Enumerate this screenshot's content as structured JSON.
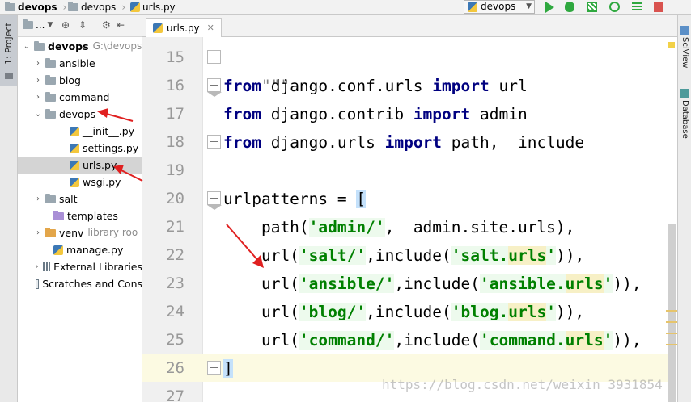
{
  "breadcrumb": [
    "devops",
    "devops",
    "urls.py"
  ],
  "run_config": "devops",
  "project_panel": {
    "title": "...",
    "root_name": "devops",
    "root_path": "G:\\devops",
    "items": [
      {
        "label": "ansible",
        "type": "folder",
        "expand": "closed"
      },
      {
        "label": "blog",
        "type": "folder",
        "expand": "closed"
      },
      {
        "label": "command",
        "type": "folder",
        "expand": "closed"
      },
      {
        "label": "devops",
        "type": "folder",
        "expand": "open"
      },
      {
        "label": "__init__.py",
        "type": "py"
      },
      {
        "label": "settings.py",
        "type": "py"
      },
      {
        "label": "urls.py",
        "type": "py"
      },
      {
        "label": "wsgi.py",
        "type": "py"
      },
      {
        "label": "salt",
        "type": "folder",
        "expand": "closed"
      },
      {
        "label": "templates",
        "type": "folder"
      },
      {
        "label": "venv",
        "type": "folder",
        "expand": "closed",
        "meta": "library roo"
      },
      {
        "label": "manage.py",
        "type": "py"
      },
      {
        "label": "External Libraries",
        "type": "lib"
      },
      {
        "label": "Scratches and Cons",
        "type": "scratch"
      }
    ]
  },
  "left_tool_tab": "1: Project",
  "right_tool_tabs": [
    "SciView",
    "Database"
  ],
  "editor_tab": "urls.py",
  "line_numbers": [
    "15",
    "16",
    "17",
    "18",
    "19",
    "20",
    "21",
    "22",
    "23",
    "24",
    "25",
    "26",
    "27"
  ],
  "code": {
    "l15": "\"\"\"",
    "kw_from": "from",
    "kw_import": "import",
    "l16_mod": " django.conf.urls ",
    "l16_name": " url",
    "l17_mod": " django.contrib ",
    "l17_name": " admin",
    "l18_mod": " django.urls ",
    "l18_name": " path,  include",
    "l20_var": "urlpatterns = ",
    "l20_bracket": "[",
    "l21_pre": "    path(",
    "l21_str": "'admin/'",
    "l21_post": ",  admin.site.urls),",
    "url_pre": "    url(",
    "include_pre": ",include(",
    "urls_word": "urls",
    "close": ")),",
    "l22_route": "'salt/'",
    "l22_q1": "'salt.",
    "l23_route": "'ansible/'",
    "l23_q1": "'ansible.",
    "l24_route": "'blog/'",
    "l24_q1": "'blog.",
    "l25_route": "'command/'",
    "l25_q1": "'command.",
    "q": "'",
    "l26": "]"
  },
  "watermark": "https://blog.csdn.net/weixin_3931854"
}
